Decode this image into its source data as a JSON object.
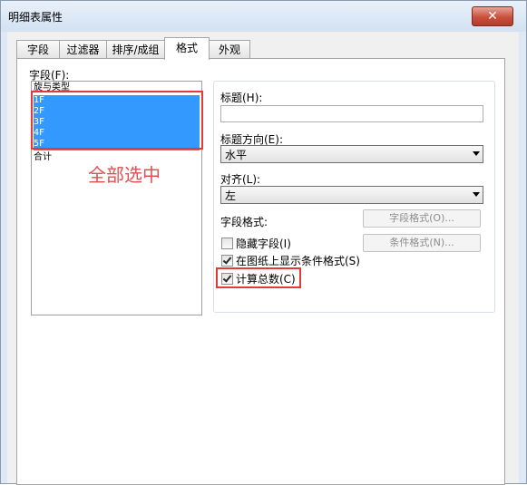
{
  "window": {
    "title": "明细表属性",
    "close_label": "✕"
  },
  "tabs": [
    {
      "label": "字段"
    },
    {
      "label": "过滤器"
    },
    {
      "label": "排序/成组"
    },
    {
      "label": "格式"
    },
    {
      "label": "外观"
    }
  ],
  "fields": {
    "label": "字段(F):",
    "items": [
      "旋与类型",
      "1F",
      "2F",
      "3F",
      "4F",
      "5F",
      "合计"
    ],
    "selected": [
      "1F",
      "2F",
      "3F",
      "4F",
      "5F"
    ]
  },
  "annotation": {
    "text": "全部选中",
    "color": "#e05050"
  },
  "format": {
    "heading_label": "标题(H):",
    "heading_value": "",
    "orientation_label": "标题方向(E):",
    "orientation_value": "水平",
    "align_label": "对齐(L):",
    "align_value": "左",
    "field_format_label": "字段格式:",
    "field_format_button": "字段格式(O)...",
    "hidden_field_label": "隐藏字段(I)",
    "hidden_field_checked": false,
    "conditional_format_button": "条件格式(N)...",
    "show_conditional_label": "在图纸上显示条件格式(S)",
    "show_conditional_checked": true,
    "calc_totals_label": "计算总数(C)",
    "calc_totals_checked": true
  },
  "colors": {
    "selection": "#3399ff",
    "highlight_box": "#e03a3a",
    "close_button": "#c8503c"
  }
}
